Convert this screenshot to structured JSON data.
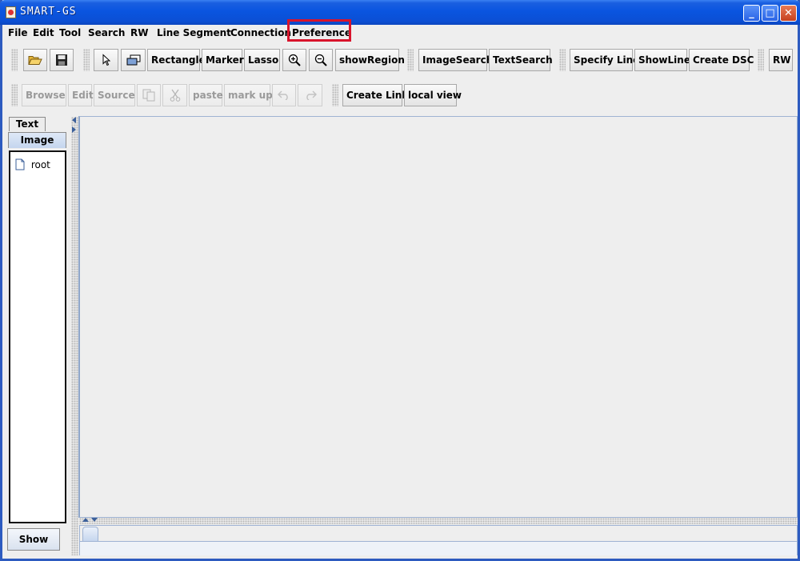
{
  "window": {
    "title": "SMART-GS",
    "controls": {
      "minimize": "_",
      "maximize": "□",
      "close": "✕"
    }
  },
  "menubar": {
    "items": [
      "File",
      "Edit",
      "Tool",
      "Search",
      "RW",
      "Line Segment",
      "Connection",
      "Preference"
    ]
  },
  "toolbar1": {
    "open_icon": "folder-open-icon",
    "save_icon": "floppy-save-icon",
    "select_icon": "arrow-pointer-icon",
    "eraser_icon": "eraser-icon",
    "rectangle": "Rectangle",
    "marker": "Marker",
    "lasso": "Lasso",
    "zoom_in_icon": "zoom-in-icon",
    "zoom_out_icon": "zoom-out-icon",
    "show_region": "showRegion",
    "image_search": "ImageSearch",
    "text_search": "TextSearch",
    "specify_line": "Specify Line",
    "show_line": "ShowLine",
    "create_dsc": "Create DSC",
    "rw": "RW"
  },
  "toolbar2": {
    "browse": "Browse",
    "edit": "Edit",
    "source": "Source",
    "copy_icon": "copy-icon",
    "cut_icon": "scissors-icon",
    "paste": "paste",
    "mark_up": "mark up",
    "undo_icon": "undo-icon",
    "redo_icon": "redo-icon",
    "create_link": "Create Link",
    "local_view": "local view"
  },
  "left_panel": {
    "tabs": [
      {
        "label": "Text",
        "active": false
      },
      {
        "label": "Image",
        "active": true
      }
    ],
    "tree": [
      {
        "label": "root",
        "icon": "file-icon"
      }
    ],
    "show_button": "Show"
  },
  "colors": {
    "titlebar": "#0a55e0",
    "highlight": "#d9142c",
    "background": "#eeeeee"
  }
}
